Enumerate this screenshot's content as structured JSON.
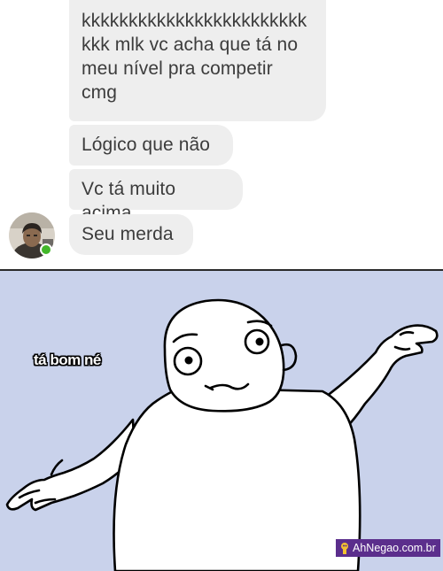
{
  "chat": {
    "messages": [
      {
        "text": "kkkkkkkkkkkkkkkkkkkkkkkk\nkkk mlk vc acha que tá no\nmeu nível pra competir\ncmg"
      },
      {
        "text": "Lógico que não"
      },
      {
        "text": "Vc tá muito acima"
      },
      {
        "text": "Seu merda"
      }
    ],
    "online_color": "#42b72a",
    "bubble_color": "#eeeeee"
  },
  "meme": {
    "caption": "tá bom né",
    "background_color": "#c9d2eb",
    "figure": "shrugging-rage-face"
  },
  "watermark": {
    "text": "AhNegao.com.br",
    "color": "#5b2e8c"
  }
}
